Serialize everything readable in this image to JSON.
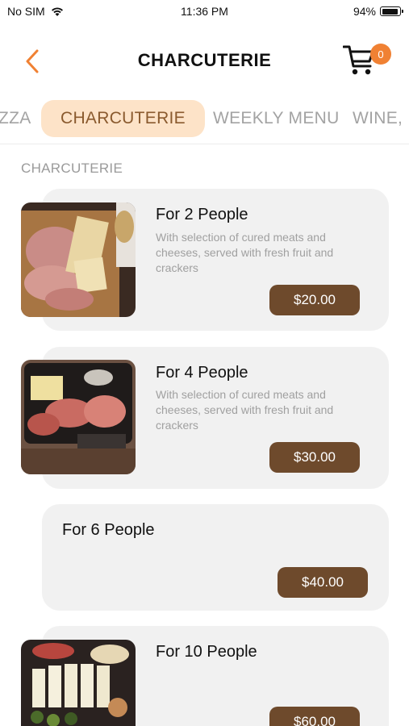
{
  "status_bar": {
    "carrier": "No SIM",
    "time": "11:36 PM",
    "battery": "94%"
  },
  "nav": {
    "title": "CHARCUTERIE",
    "cart_count": "0",
    "accent_color": "#f08133"
  },
  "tabs": [
    {
      "label": "ZZA",
      "active": false
    },
    {
      "label": "CHARCUTERIE",
      "active": true
    },
    {
      "label": "WEEKLY MENU",
      "active": false
    },
    {
      "label": "WINE,",
      "active": false
    }
  ],
  "section": {
    "label": "CHARCUTERIE"
  },
  "items": [
    {
      "title": "For 2 People",
      "description": "With selection of cured meats and cheeses, served with fresh fruit and crackers",
      "price": "$20.00",
      "has_image": true
    },
    {
      "title": "For 4 People",
      "description": "With selection of cured meats and cheeses, served with fresh fruit and crackers",
      "price": "$30.00",
      "has_image": true
    },
    {
      "title": "For 6 People",
      "description": "",
      "price": "$40.00",
      "has_image": false
    },
    {
      "title": "For 10 People",
      "description": "",
      "price": "$60.00",
      "has_image": true
    }
  ],
  "colors": {
    "price_button": "#6e4a2c",
    "active_tab_bg": "#fde3c8",
    "active_tab_text": "#8a5a2e",
    "card_bg": "#f1f1f1"
  }
}
